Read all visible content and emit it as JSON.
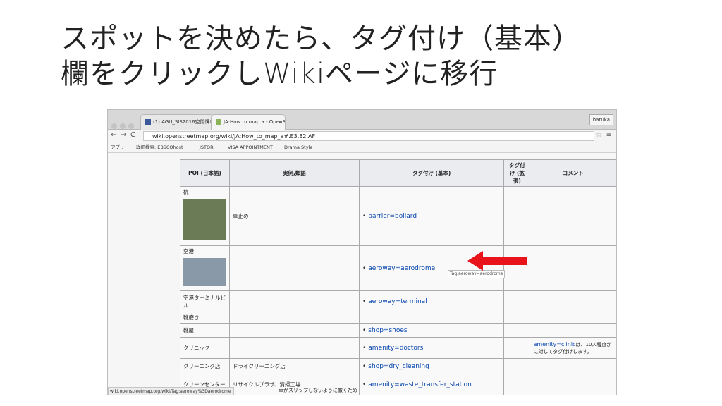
{
  "slide": {
    "title_line1": "スポットを決めたら、タグ付け（基本）",
    "title_line2": "欄をクリックしWikiページに移行"
  },
  "browser": {
    "tabs": [
      {
        "label": "(1) AGU_SIS2016空間情報"
      },
      {
        "label": "JA:How to map a - OpenS"
      }
    ],
    "profile": "haruka",
    "url": "wiki.openstreetmap.org/wiki/JA:How_to_map_a#.E3.82.AF",
    "bookmarks": [
      "アプリ",
      "詳細検索: EBSCOhost",
      "JSTOR",
      "VISA APPOINTMENT",
      "Drama Style"
    ],
    "status_url": "wiki.openstreetmap.org/wiki/Tag:aeroway%3Daerodrome",
    "tooltip": "Tag:aeroway=aerodrome"
  },
  "table": {
    "headers": [
      "POI (日本語)",
      "実例,類語",
      "タグ付け (基本)",
      "タグ付け (拡張)",
      "コメント"
    ],
    "rows": [
      {
        "poi": "杭",
        "example": "車止め",
        "tag": "barrier=bollard",
        "comment": ""
      },
      {
        "poi": "空港",
        "example": "",
        "tag": "aeroway=aerodrome",
        "comment": ""
      },
      {
        "poi": "空港ターミナルビル",
        "example": "",
        "tag": "aeroway=terminal",
        "comment": ""
      },
      {
        "poi": "靴磨き",
        "example": "",
        "tag": "",
        "comment": ""
      },
      {
        "poi": "靴屋",
        "example": "",
        "tag": "shop=shoes",
        "comment": ""
      },
      {
        "poi": "クリニック",
        "example": "",
        "tag": "amenity=doctors",
        "comment_link": "amenity=clinic",
        "comment": "は、10人程度が に対してタグ付けします。"
      },
      {
        "poi": "クリーニング店",
        "example": "ドライクリーニング店",
        "tag": "shop=dry_cleaning",
        "comment": ""
      },
      {
        "poi": "クリーンセンター",
        "example": "リサイクルプラザ、清掃工場",
        "tag": "amenity=waste_transfer_station",
        "comment": ""
      }
    ],
    "bottom_fragment": "車がスリップしないように撒くため"
  },
  "colors": {
    "arrow": "#e8131b",
    "link": "#0645ad"
  }
}
